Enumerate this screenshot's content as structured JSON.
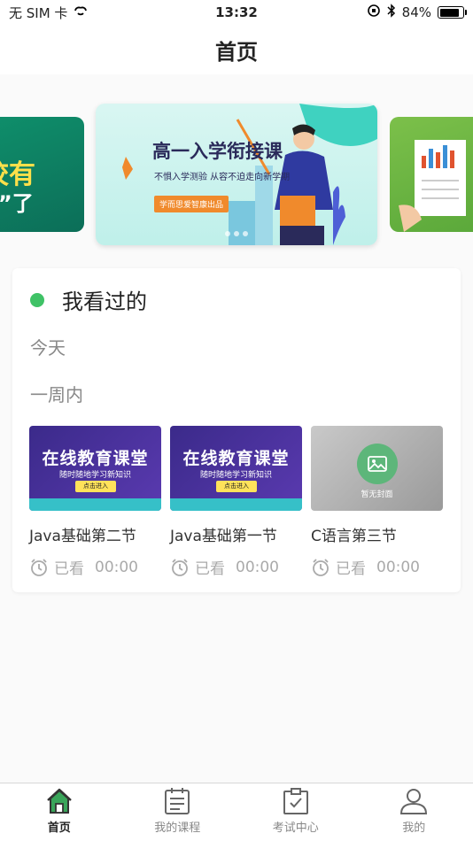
{
  "status_bar": {
    "carrier": "无 SIM 卡",
    "time": "13:32",
    "battery": "84%",
    "battery_level": 0.84
  },
  "nav": {
    "title": "首页"
  },
  "banner": {
    "left": {
      "line1": "校有",
      "line2": "P”了"
    },
    "main": {
      "headline": "高一入学衔接课",
      "subline": "不惧入学测验 从容不迫走向新学期",
      "tag": "学而思爱智康出品"
    }
  },
  "history": {
    "title": "我看过的",
    "today_label": "今天",
    "week_label": "一周内",
    "courses": [
      {
        "name": "Java基础第二节",
        "status": "已看",
        "time": "00:00",
        "thumb_title": "在线教育课堂",
        "thumb_sub": "随时随地学习新知识",
        "thumb_cta": "点击进入"
      },
      {
        "name": "Java基础第一节",
        "status": "已看",
        "time": "00:00",
        "thumb_title": "在线教育课堂",
        "thumb_sub": "随时随地学习新知识",
        "thumb_cta": "点击进入"
      },
      {
        "name": "C语言第三节",
        "status": "已看",
        "time": "00:00",
        "thumb_caption": "暂无封面"
      }
    ]
  },
  "tabs": [
    {
      "label": "首页",
      "icon": "home-icon",
      "active": true
    },
    {
      "label": "我的课程",
      "icon": "calendar-icon",
      "active": false
    },
    {
      "label": "考试中心",
      "icon": "clipboard-check-icon",
      "active": false
    },
    {
      "label": "我的",
      "icon": "person-icon",
      "active": false
    }
  ],
  "colors": {
    "accent": "#3fc266",
    "tab_active": "#3aa55a"
  }
}
